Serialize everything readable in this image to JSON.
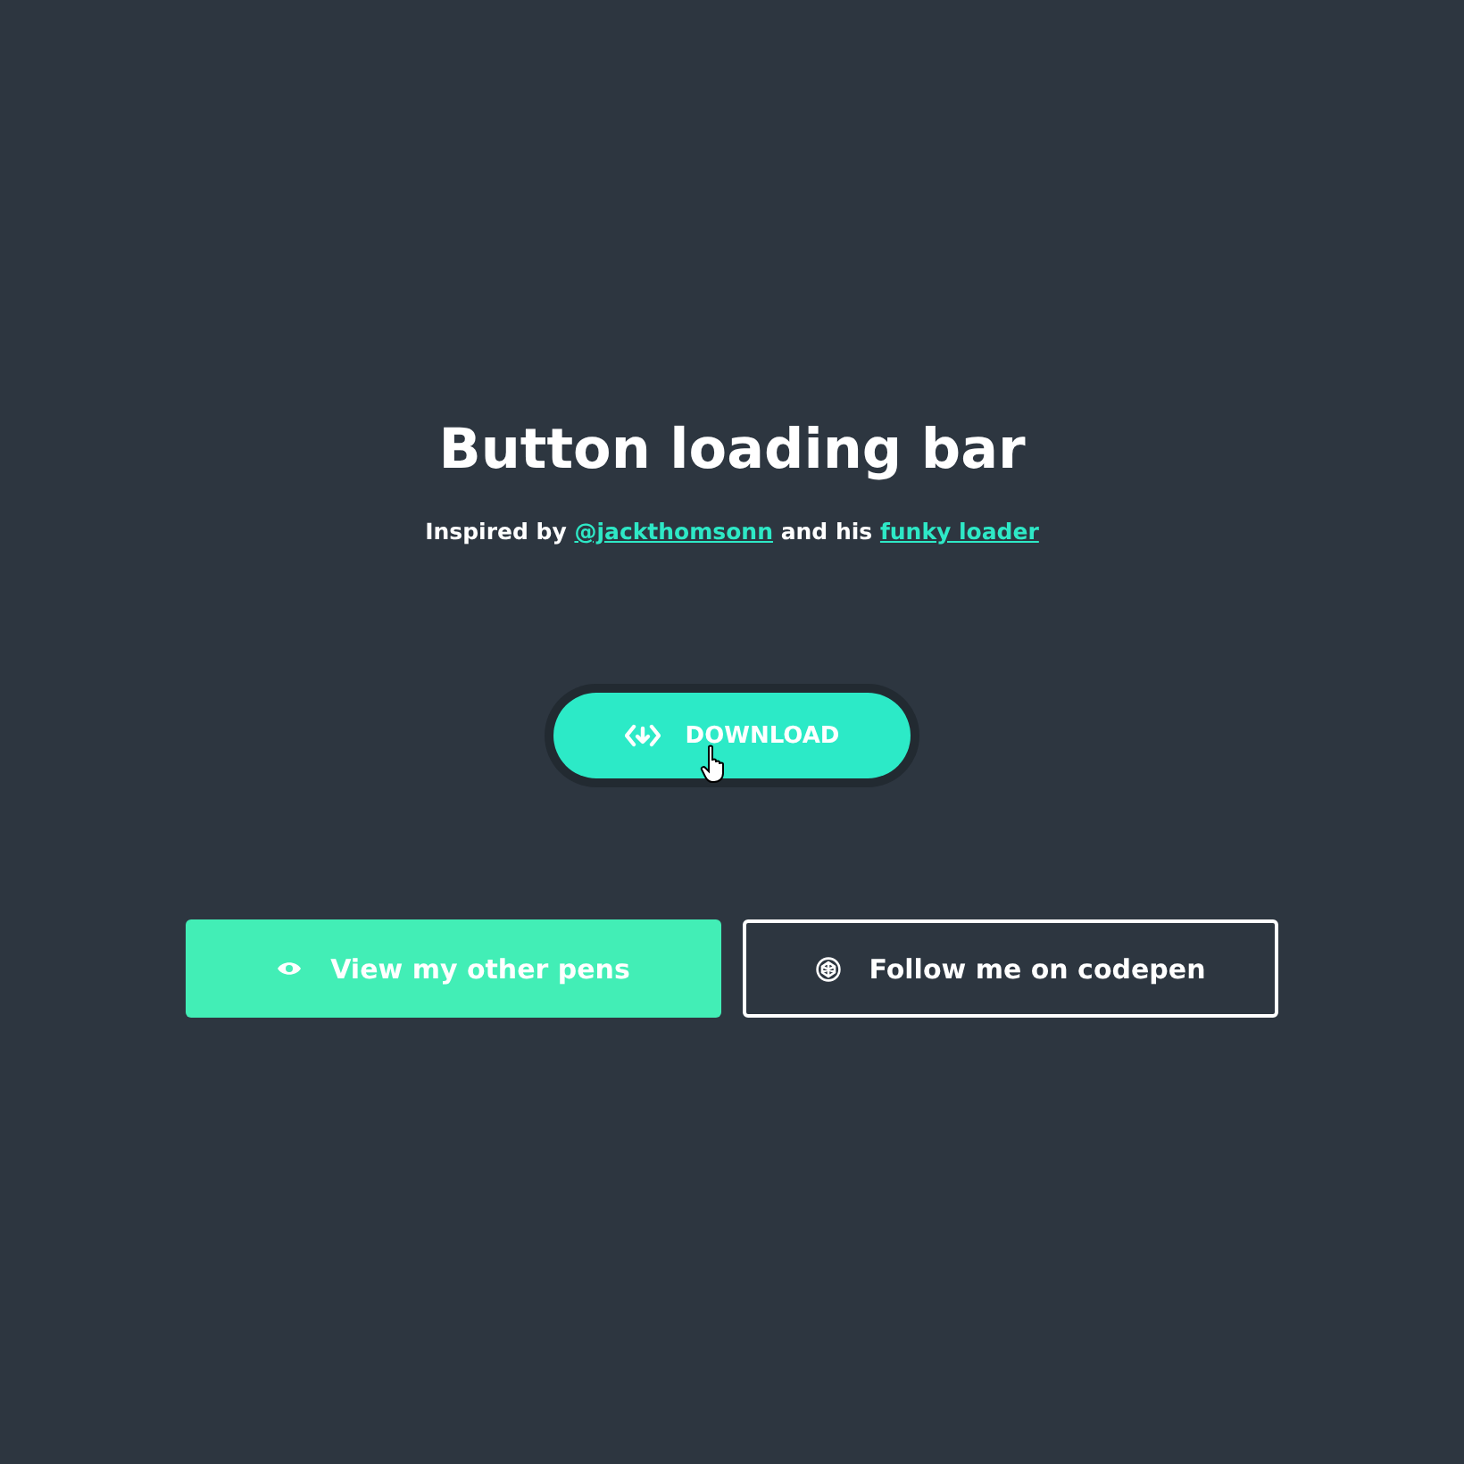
{
  "title": "Button loading bar",
  "subtitle": {
    "prefix": "Inspired by ",
    "link_1": "@jackthomsonn",
    "middle": " and his ",
    "link_2": "funky loader"
  },
  "download_button": {
    "label": "DOWNLOAD"
  },
  "links": [
    {
      "label": "View my other pens",
      "kind": "filled"
    },
    {
      "label": "Follow me on codepen",
      "kind": "outline"
    }
  ]
}
